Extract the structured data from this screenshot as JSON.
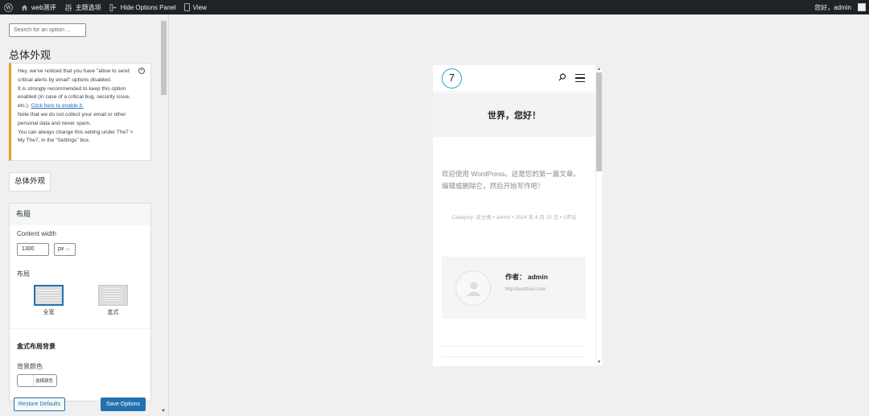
{
  "adminbar": {
    "site_name": "web测评",
    "theme_options": "主题选项",
    "hide_panel": "Hide Options Panel",
    "view": "View",
    "greeting": "您好，admin"
  },
  "panel": {
    "search_placeholder": "Search for an option ...",
    "title": "总体外观",
    "notice": {
      "line1": "Hey, we've noticed that you have \"allow to send critical alerts by email\" options disabled.",
      "line2": "It is strongly recommended to keep this option enabled (in case of a critical bug, security issue, etc.).",
      "link": "Click here to enable it.",
      "line3": "Note that we do not collect your email or other personal data and never spam.",
      "line4": "You can always change this setting under The7 > My The7, in the \"Settings\" box."
    },
    "tab": "总体外观",
    "section": {
      "title": "布局",
      "content_width_label": "Content width",
      "content_width_value": "1300",
      "unit": "px",
      "layout_label": "布局",
      "layout_full": "全宽",
      "layout_boxed": "盒式",
      "boxed_bg_title": "盒式布局背景",
      "bg_color_label": "背景颜色",
      "select_color": "选择颜色"
    },
    "restore_label": "Restore Defaults",
    "save_label": "Save Options"
  },
  "preview": {
    "logo_text": "7",
    "hero_title": "世界，您好！",
    "excerpt": "欢迎使用 WordPress。这是您的第一篇文章。编辑或删除它，然后开始写作吧！",
    "meta": "Category: 未分类 • admin • 2024 年 4 月 22 日 • 1评论",
    "author_name": "作者： admin",
    "author_url": "http://tuozhusi.com"
  }
}
